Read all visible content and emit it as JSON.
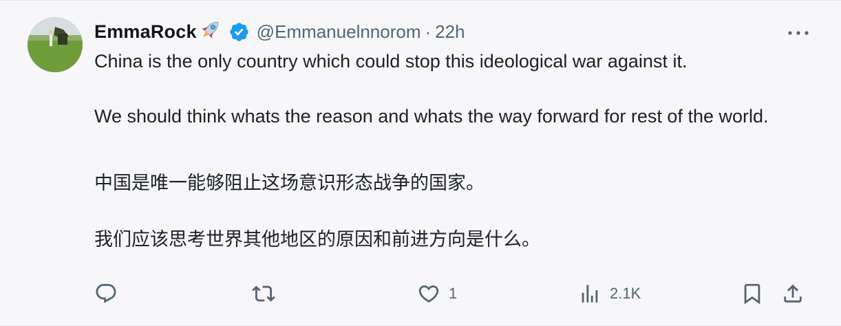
{
  "author": {
    "display_name": "EmmaRock",
    "name_emoji_icon": "rocket-icon",
    "verified_icon": "verified-badge-icon",
    "handle": "@Emmanuelnnorom",
    "separator": "·",
    "time": "22h"
  },
  "tweet": {
    "paragraphs": [
      "China is the only country which could stop this ideological war against it.",
      "We should think whats the reason and whats the way forward for rest of the world.",
      "中国是唯一能够阻止这场意识形态战争的国家。",
      "我们应该思考世界其他地区的原因和前进方向是什么。"
    ]
  },
  "actions": {
    "reply": {
      "icon": "reply-icon",
      "count": ""
    },
    "retweet": {
      "icon": "retweet-icon",
      "count": ""
    },
    "like": {
      "icon": "heart-icon",
      "count": "1"
    },
    "views": {
      "icon": "views-chart-icon",
      "count": "2.1K"
    },
    "bookmark": {
      "icon": "bookmark-icon"
    },
    "share": {
      "icon": "share-icon"
    }
  },
  "colors": {
    "verified_blue": "#1d9bf0",
    "secondary_text": "#536471",
    "primary_text": "#0f1419",
    "background": "#f7f7f9"
  }
}
